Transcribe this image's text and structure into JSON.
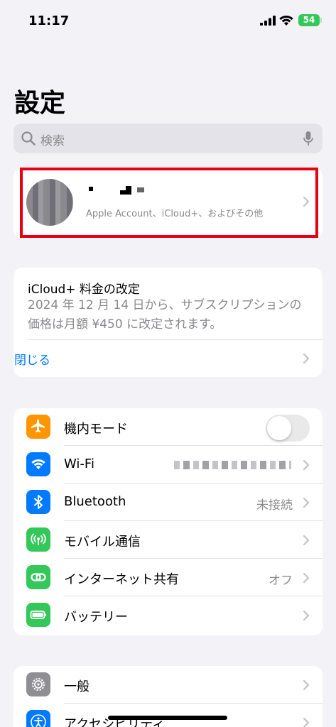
{
  "status_bar": {
    "time": "11:17",
    "battery": "54"
  },
  "page_title": "設定",
  "search": {
    "placeholder": "検索"
  },
  "profile": {
    "subtitle": "Apple Account、iCloud+、およびその他"
  },
  "notice": {
    "title": "iCloud+ 料金の改定",
    "body": "2024 年 12 月 14 日から、サブスクリプションの価格は月額 ¥450 に改定されます。",
    "close_label": "閉じる"
  },
  "settings_group_1": [
    {
      "label": "機内モード",
      "value": "",
      "icon": "airplane-icon",
      "color": "#ff9500"
    },
    {
      "label": "Wi-Fi",
      "value": "",
      "icon": "wifi-icon",
      "color": "#007aff"
    },
    {
      "label": "Bluetooth",
      "value": "未接続",
      "icon": "bluetooth-icon",
      "color": "#007aff"
    },
    {
      "label": "モバイル通信",
      "value": "",
      "icon": "antenna-icon",
      "color": "#34c759"
    },
    {
      "label": "インターネット共有",
      "value": "オフ",
      "icon": "link-icon",
      "color": "#34c759"
    },
    {
      "label": "バッテリー",
      "value": "",
      "icon": "battery-icon",
      "color": "#34c759"
    }
  ],
  "settings_group_2": [
    {
      "label": "一般",
      "icon": "gear-icon",
      "color": "#8e8e93"
    },
    {
      "label": "アクセシビリティ",
      "icon": "accessibility-icon",
      "color": "#007aff"
    }
  ],
  "toggles": {
    "airplane_mode": false
  }
}
